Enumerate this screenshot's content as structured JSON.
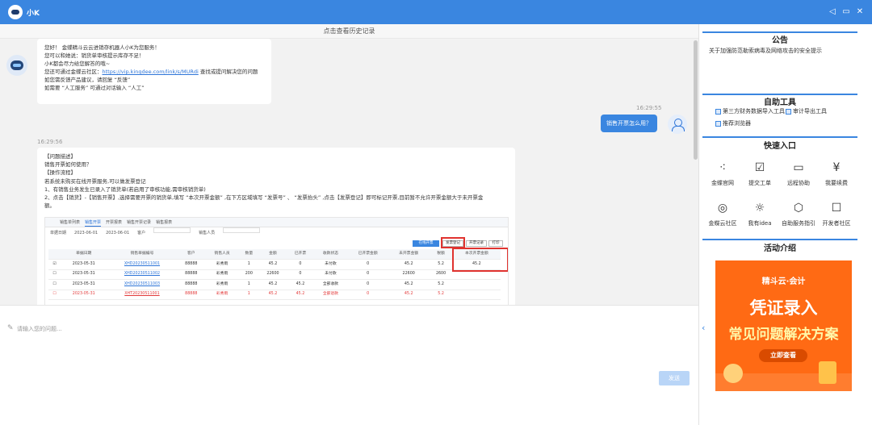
{
  "app": {
    "title": "小K"
  },
  "window_icons": [
    "volume-icon",
    "minimize-icon",
    "close-icon"
  ],
  "history": {
    "label": "点击查看历史记录"
  },
  "bot_message_1": {
    "lines": [
      "您好！ 金蝶精斗云云进销存机器人小K为您服务！",
      "您可以和她说：销货单审核提示库存不足！",
      "小K都会尽力给您解答的哦~",
      "您还可通过金蝶云社区：",
      "如您需反馈产品建议，请回复 “反馈”",
      "如需要 “人工服务” 可通过对话输入 “人工”"
    ],
    "link": "https://vip.kingdee.com/link/s/MURdi",
    "link_suffix": " 查找或提问解决您的问题"
  },
  "user_message": {
    "time": "16:29:55",
    "text": "销售开票怎么用？"
  },
  "bot_message_2": {
    "time": "16:29:56",
    "lines": [
      "【问题描述】",
      "销售开票如何使用？",
      "【操作流程】",
      "若系统未购买在线开票服务,可以做发票登记",
      "1、有销售业务发生已录入了销货单(若启用了审核功能,需审核销货单)",
      "2、点击【销货】-【销售开票】,选择需要开票的销货单,填写 “本次开票金额” ,在下方区域填写 “发票号” 、 “发票抬头” ,点击【发票登记】即可标记开票,目前暂不允许开票金额大于未开票金",
      "额。"
    ]
  },
  "screenshot": {
    "tabs": [
      "销售单列表",
      "销售开票",
      "开票报表",
      "销售开票记录",
      "销售报表"
    ],
    "filters": [
      "单据日期",
      "2023-06-01",
      "2023-06-01",
      "客户",
      "销售人员"
    ],
    "actions": {
      "online": "在线开票",
      "register": "发票登记",
      "export": "开票记录",
      "print": "打印"
    },
    "headers": [
      "",
      "单据日期",
      "销售单据编号",
      "客户",
      "销售人员",
      "数量",
      "金额",
      "已开票",
      "收款状态",
      "已开票金额",
      "未开票金额",
      "税额",
      "本次开票金额"
    ],
    "rows": [
      {
        "cells": [
          "2023-05-31",
          "XHD20230511001",
          "88888",
          "彩秀雨",
          "1",
          "45.2",
          "0",
          "未付款",
          "0",
          "45.2",
          "5.2",
          "45.2"
        ],
        "checked": true,
        "red": false
      },
      {
        "cells": [
          "2023-05-31",
          "XHD20230511002",
          "88888",
          "彩秀雨",
          "200",
          "22600",
          "0",
          "未付款",
          "0",
          "22600",
          "2600",
          ""
        ],
        "checked": false,
        "red": false
      },
      {
        "cells": [
          "2023-05-31",
          "XHD20230511003",
          "88888",
          "彩秀雨",
          "1",
          "45.2",
          "45.2",
          "全部收款",
          "0",
          "45.2",
          "5.2",
          ""
        ],
        "checked": false,
        "red": false
      },
      {
        "cells": [
          "2023-05-31",
          "XHT20230511001",
          "88888",
          "彩秀雨",
          "1",
          "45.2",
          "45.2",
          "全部退款",
          "0",
          "45.2",
          "5.2",
          ""
        ],
        "checked": false,
        "red": true
      }
    ]
  },
  "input": {
    "placeholder": "请输入您的问题...",
    "send_label": "发送"
  },
  "notice": {
    "title": "公告",
    "text": "关于加强防范勒索病毒及网络攻击的安全提示"
  },
  "tools": {
    "title": "自助工具",
    "items": [
      "第三方财务数据导入工具",
      "审计导出工具",
      "推荐浏览器"
    ]
  },
  "quick": {
    "title": "快速入口",
    "items": [
      {
        "label": "金蝶官网",
        "icon": "dots-icon"
      },
      {
        "label": "提交工单",
        "icon": "clipboard-check-icon"
      },
      {
        "label": "远程协助",
        "icon": "monitor-icon"
      },
      {
        "label": "我要续费",
        "icon": "yuan-icon"
      },
      {
        "label": "金蝶云社区",
        "icon": "planet-icon"
      },
      {
        "label": "我有idea",
        "icon": "lightbulb-icon"
      },
      {
        "label": "自助服务指引",
        "icon": "cube-icon"
      },
      {
        "label": "开发者社区",
        "icon": "checklist-icon"
      }
    ]
  },
  "activity": {
    "title": "活动介绍",
    "banner": {
      "top": "精斗云·会计",
      "title": "凭证录入",
      "subtitle": "常见问题解决方案",
      "button": "立即查看"
    }
  }
}
